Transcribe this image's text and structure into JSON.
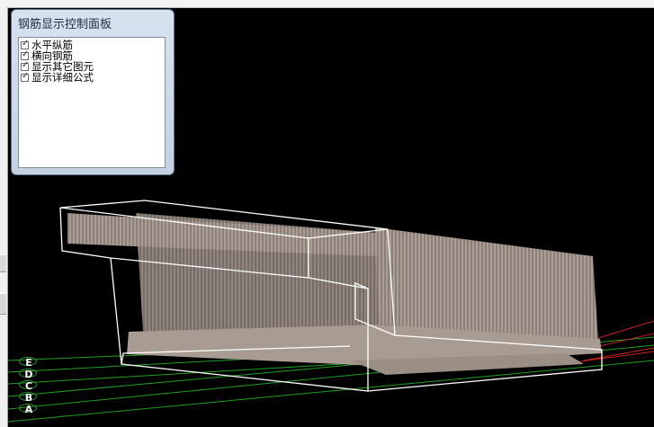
{
  "panel": {
    "title": "钢筋显示控制面板",
    "items": [
      {
        "label": "水平纵筋",
        "checked": true
      },
      {
        "label": "横向钢筋",
        "checked": true
      },
      {
        "label": "显示其它图元",
        "checked": true
      },
      {
        "label": "显示详细公式",
        "checked": true
      }
    ]
  },
  "axis_labels": [
    "E",
    "D",
    "C",
    "B",
    "A"
  ],
  "icons": {
    "checkbox_tick": "✓"
  },
  "colors": {
    "rebar": "#a89b92",
    "outline": "#ffffff",
    "grid_green": "#1fa01f",
    "grid_red": "#c82020",
    "background": "#000000"
  }
}
